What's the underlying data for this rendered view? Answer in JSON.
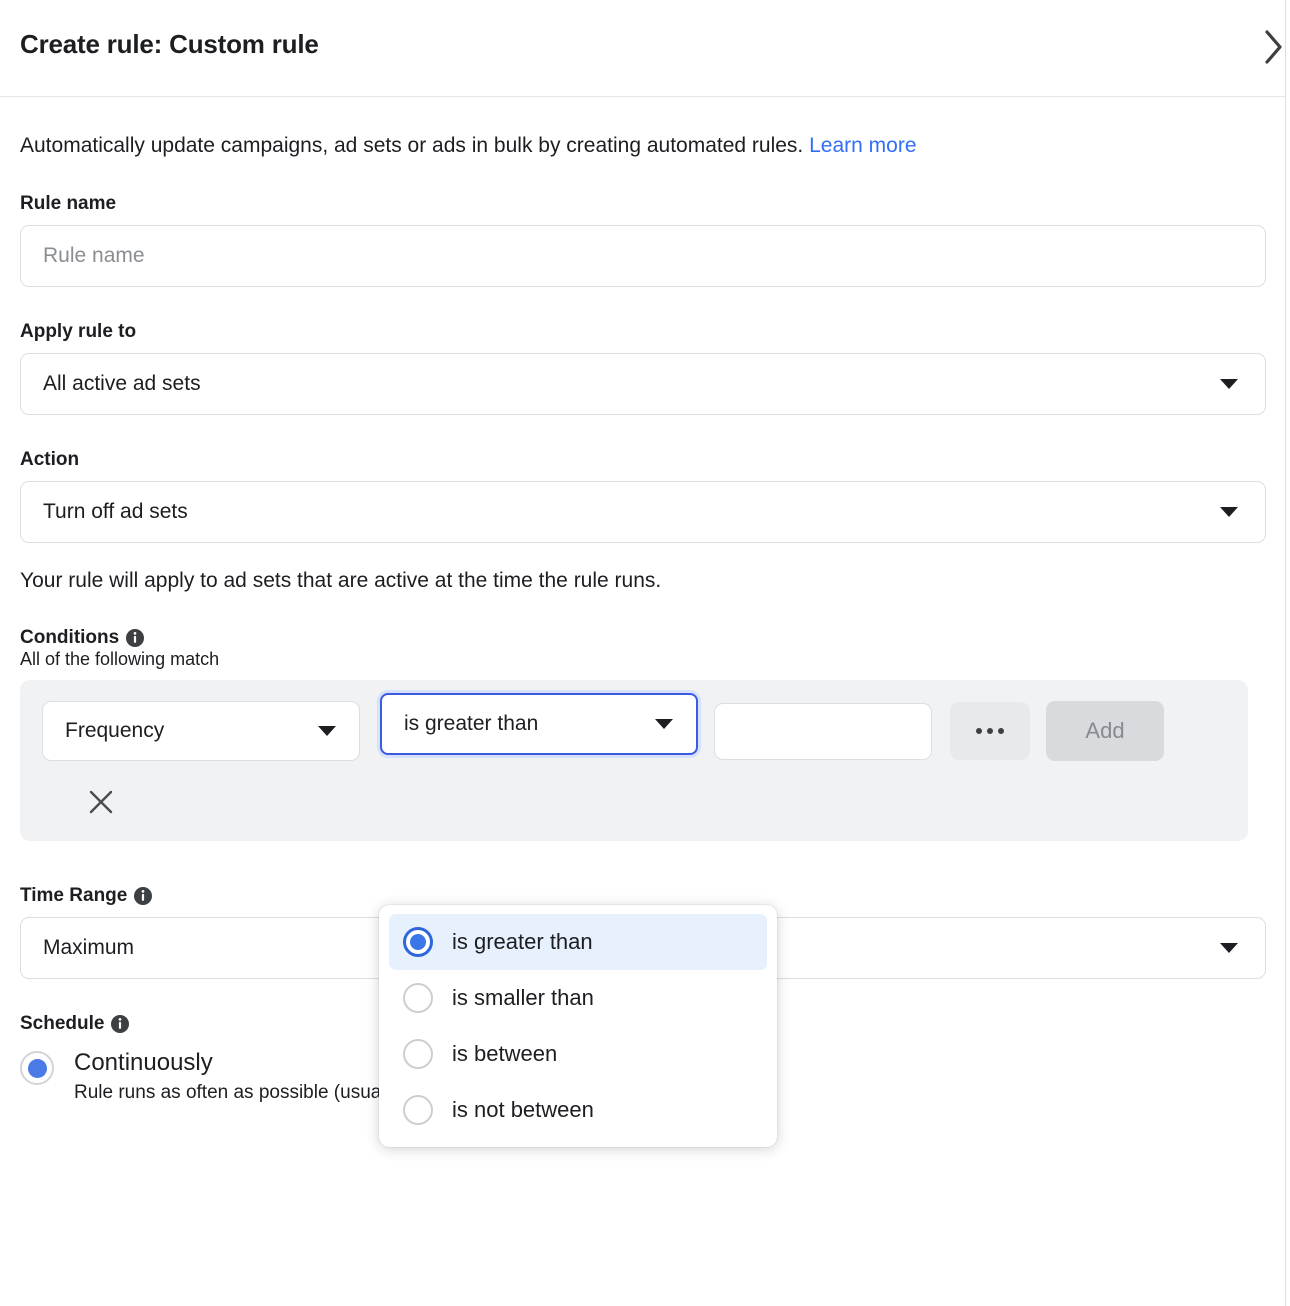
{
  "header": {
    "title": "Create rule: Custom rule",
    "close_icon": "chevron-right-icon"
  },
  "intro": {
    "text": "Automatically update campaigns, ad sets or ads in bulk by creating automated rules.",
    "link_label": "Learn more",
    "link_color": "#316ff6"
  },
  "rule_name": {
    "label": "Rule name",
    "value": "",
    "placeholder": "Rule name"
  },
  "apply_rule_to": {
    "label": "Apply rule to",
    "value": "All active ad sets"
  },
  "action": {
    "label": "Action",
    "value": "Turn off ad sets",
    "note": "Your rule will apply to ad sets that are active at the time the rule runs."
  },
  "conditions": {
    "label": "Conditions",
    "subtitle": "All of the following match",
    "metric": "Frequency",
    "operator": "is greater than",
    "value": "",
    "more_label": "…",
    "add_label": "Add",
    "remove_icon": "close-x-icon"
  },
  "operator_menu": {
    "options": [
      {
        "label": "is greater than",
        "selected": true
      },
      {
        "label": "is smaller than",
        "selected": false
      },
      {
        "label": "is between",
        "selected": false
      },
      {
        "label": "is not between",
        "selected": false
      }
    ],
    "highlight_color": "#e7f0fd",
    "radio_color": "#3b76e8"
  },
  "time_range": {
    "label": "Time Range",
    "value": "Maximum"
  },
  "schedule": {
    "label": "Schedule",
    "options": [
      {
        "title": "Continuously",
        "description": "Rule runs as often as possible (usually every 30-60 minutes).",
        "selected": true
      }
    ]
  }
}
